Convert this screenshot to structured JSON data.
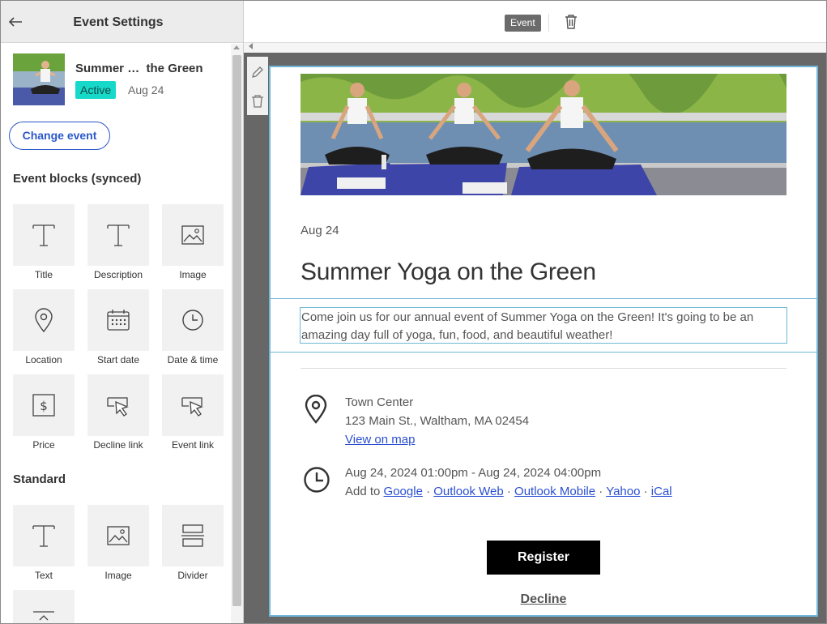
{
  "panel": {
    "title": "Event Settings"
  },
  "event": {
    "name": "Summer …  the Green",
    "status": "Active",
    "date": "Aug 24"
  },
  "change_event_label": "Change event",
  "sections": {
    "synced": "Event blocks (synced)",
    "standard": "Standard"
  },
  "synced_blocks": [
    {
      "label": "Title",
      "icon": "text-icon"
    },
    {
      "label": "Description",
      "icon": "text-icon"
    },
    {
      "label": "Image",
      "icon": "image-icon"
    },
    {
      "label": "Location",
      "icon": "location-pin-icon"
    },
    {
      "label": "Start date",
      "icon": "calendar-icon"
    },
    {
      "label": "Date & time",
      "icon": "clock-icon"
    },
    {
      "label": "Price",
      "icon": "price-icon"
    },
    {
      "label": "Decline link",
      "icon": "cursor-link-icon"
    },
    {
      "label": "Event link",
      "icon": "cursor-link-icon"
    }
  ],
  "standard_blocks": [
    {
      "label": "Text",
      "icon": "text-icon"
    },
    {
      "label": "Image",
      "icon": "image-icon"
    },
    {
      "label": "Divider",
      "icon": "divider-icon"
    }
  ],
  "toolbar": {
    "tag": "Event"
  },
  "email": {
    "date": "Aug 24",
    "title": "Summer Yoga on the Green",
    "description": "Come join us for our annual event of Summer Yoga on the Green! It's going to be an amazing day full of yoga, fun, food, and beautiful weather!",
    "location_name": "Town Center",
    "address": "123 Main St., Waltham, MA 02454",
    "map_link": "View on map",
    "datetime": "Aug 24, 2024 01:00pm - Aug 24, 2024 04:00pm",
    "add_to": "Add to",
    "calendars": [
      "Google",
      "Outlook Web",
      "Outlook Mobile",
      "Yahoo",
      "iCal"
    ],
    "separator": "·",
    "register_label": "Register",
    "decline_label": "Decline"
  },
  "colors": {
    "accent": "#2b57c9",
    "active_badge": "#17d9c9",
    "selection": "#6fb7d8",
    "canvas_bg": "#676767"
  }
}
